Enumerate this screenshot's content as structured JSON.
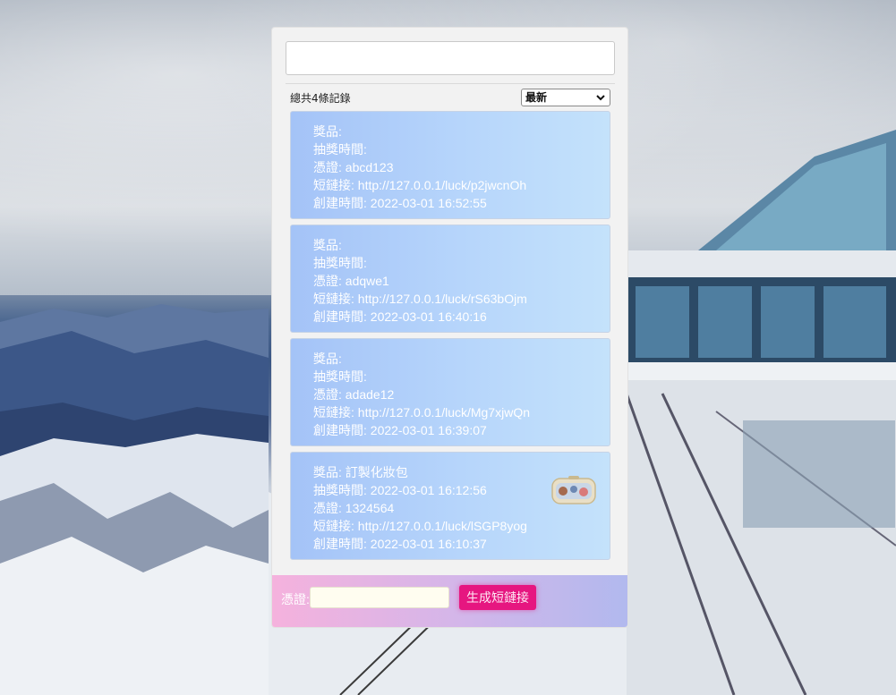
{
  "header": {
    "search_value": "",
    "record_count": "總共4條記錄",
    "sort": {
      "selected": "最新"
    }
  },
  "records": [
    {
      "prize_label": "獎品:",
      "prize": "",
      "draw_time_label": "抽獎時間:",
      "draw_time": "",
      "voucher_label": "憑證:",
      "voucher": "abcd123",
      "link_label": "短鏈接:",
      "link": "http://127.0.0.1/luck/p2jwcnOh",
      "created_label": "創建時間:",
      "created": "2022-03-01 16:52:55"
    },
    {
      "prize_label": "獎品:",
      "prize": "",
      "draw_time_label": "抽獎時間:",
      "draw_time": "",
      "voucher_label": "憑證:",
      "voucher": "adqwe1",
      "link_label": "短鏈接:",
      "link": "http://127.0.0.1/luck/rS63bOjm",
      "created_label": "創建時間:",
      "created": "2022-03-01 16:40:16"
    },
    {
      "prize_label": "獎品:",
      "prize": "",
      "draw_time_label": "抽獎時間:",
      "draw_time": "",
      "voucher_label": "憑證:",
      "voucher": "adade12",
      "link_label": "短鏈接:",
      "link": "http://127.0.0.1/luck/Mg7xjwQn",
      "created_label": "創建時間:",
      "created": "2022-03-01 16:39:07"
    },
    {
      "prize_label": "獎品:",
      "prize": "訂製化妝包",
      "draw_time_label": "抽獎時間:",
      "draw_time": "2022-03-01 16:12:56",
      "voucher_label": "憑證:",
      "voucher": "1324564",
      "link_label": "短鏈接:",
      "link": "http://127.0.0.1/luck/lSGP8yog",
      "created_label": "創建時間:",
      "created": "2022-03-01 16:10:37"
    }
  ],
  "footer": {
    "voucher_label": "憑證:",
    "voucher_value": "",
    "generate_label": "生成短鏈接"
  },
  "colors": {
    "card_from": "#a4c3f7",
    "card_to": "#c4e2fb",
    "button": "#e61680",
    "footer_from": "#f5b2dd",
    "footer_to": "#b1b9ee"
  },
  "icons": {
    "sort_chevron": "chevron-down-icon",
    "prize_image": "cosmetic-bag-image"
  }
}
